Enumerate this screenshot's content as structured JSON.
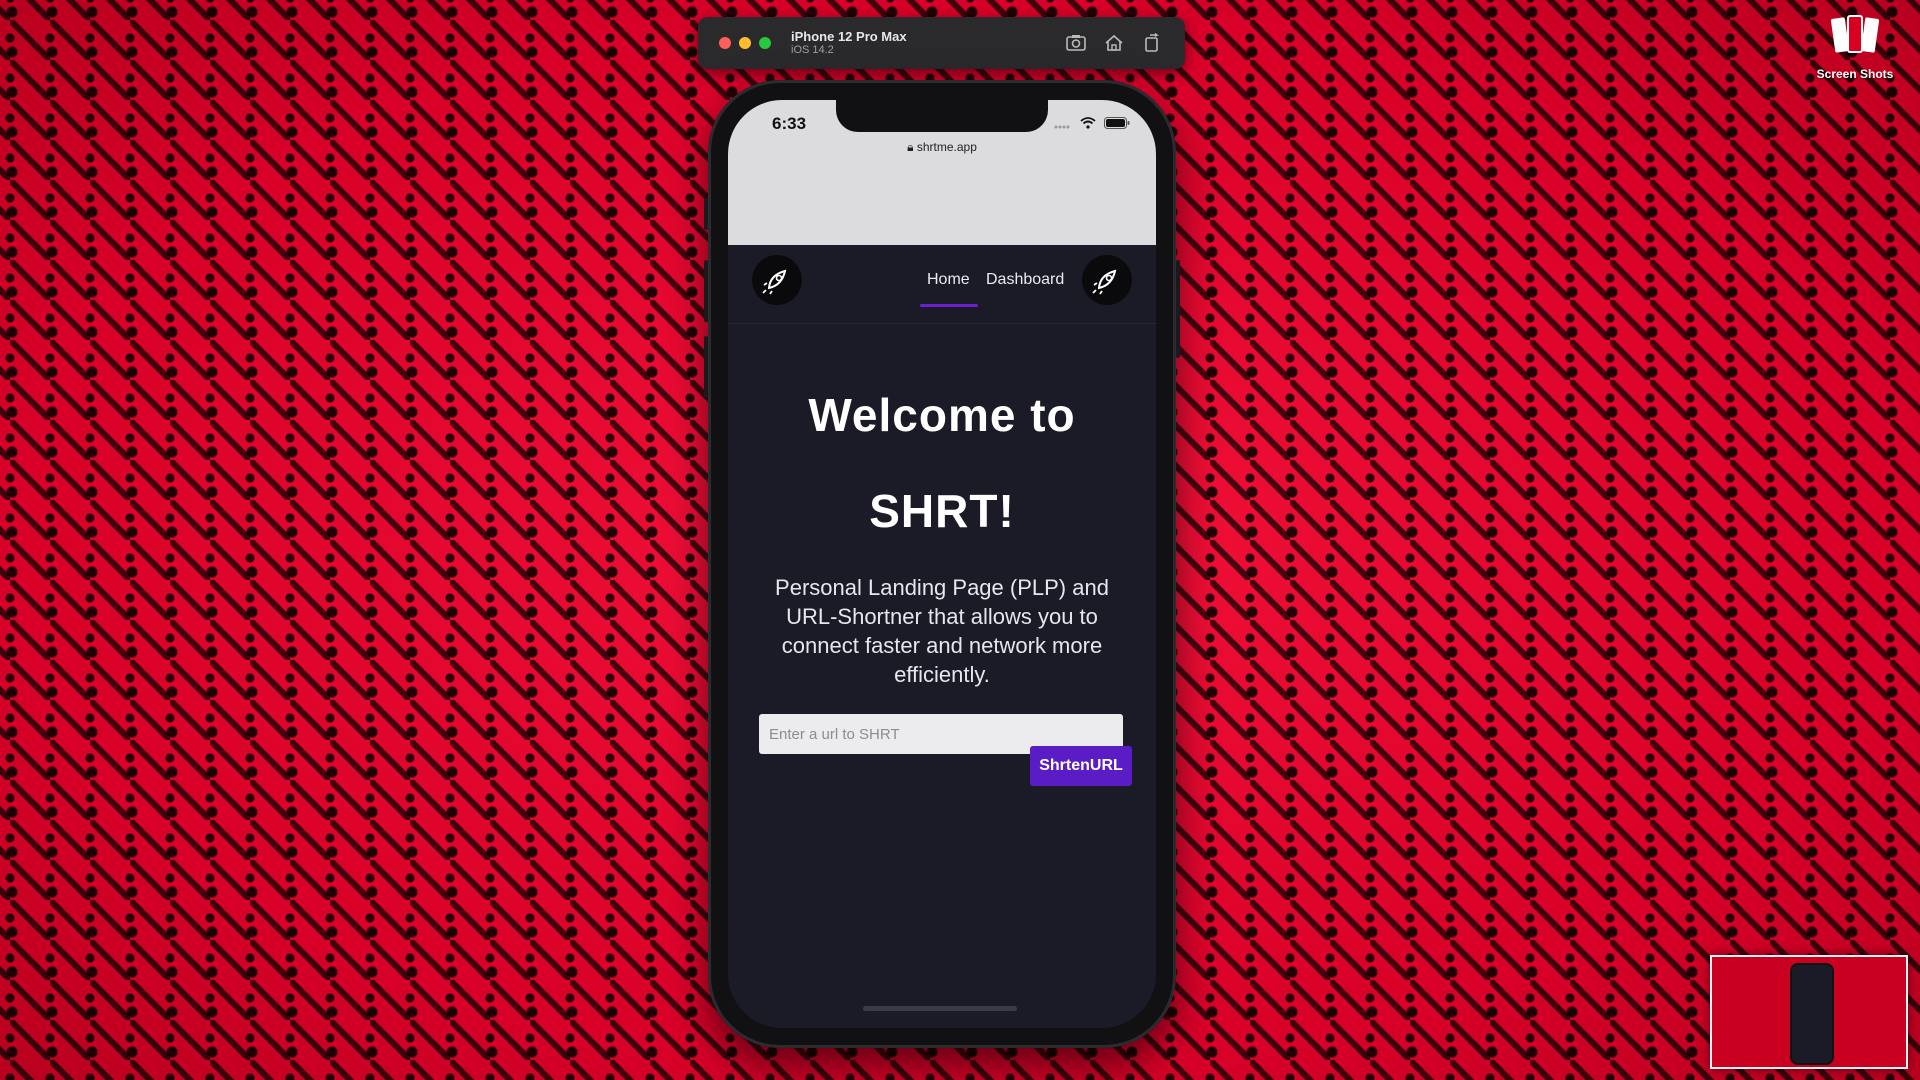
{
  "simulator": {
    "device_name": "iPhone 12 Pro Max",
    "os_version": "iOS 14.2",
    "tools": [
      "screenshot-icon",
      "home-icon",
      "rotate-icon"
    ]
  },
  "status_bar": {
    "time": "6:33",
    "url": "shrtme.app"
  },
  "nav": {
    "links": [
      {
        "label": "Home",
        "active": true
      },
      {
        "label": "Dashboard",
        "active": false
      }
    ],
    "accent_color": "#6a1fd1"
  },
  "hero": {
    "title_line1": "Welcome to",
    "title_line2": "SHRT!",
    "description": "Personal Landing Page (PLP) and URL-Shortner that allows you to connect faster and network more efficiently."
  },
  "form": {
    "url_placeholder": "Enter a url to SHRT",
    "url_value": "",
    "submit_label": "ShrtenURL",
    "submit_color": "#5a1cc4"
  },
  "desktop": {
    "screenshots_label": "Screen Shots",
    "background_color": "#e8082e"
  }
}
